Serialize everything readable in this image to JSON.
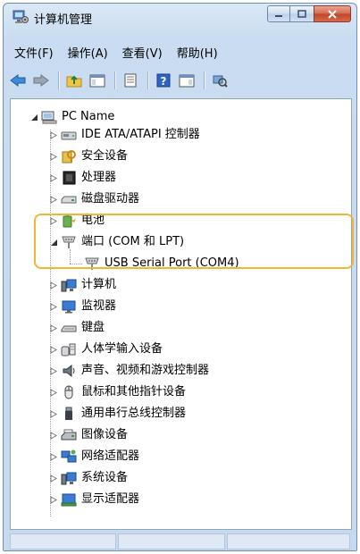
{
  "window": {
    "title": "计算机管理"
  },
  "menu": [
    {
      "label": "文件(F)"
    },
    {
      "label": "操作(A)"
    },
    {
      "label": "查看(V)"
    },
    {
      "label": "帮助(H)"
    }
  ],
  "tree": {
    "root": {
      "label": "PC Name",
      "expanded": true
    },
    "items": [
      {
        "label": "IDE ATA/ATAPI 控制器",
        "icon": "ide-controller-icon"
      },
      {
        "label": "安全设备",
        "icon": "security-device-icon"
      },
      {
        "label": "处理器",
        "icon": "processor-icon"
      },
      {
        "label": "磁盘驱动器",
        "icon": "disk-drive-icon"
      },
      {
        "label": "电池",
        "icon": "battery-icon"
      },
      {
        "label": "端口 (COM 和 LPT)",
        "icon": "port-icon",
        "expanded": true,
        "children": [
          {
            "label": "USB Serial Port (COM4)",
            "icon": "port-icon"
          }
        ]
      },
      {
        "label": "计算机",
        "icon": "computer-icon"
      },
      {
        "label": "监视器",
        "icon": "monitor-icon"
      },
      {
        "label": "键盘",
        "icon": "keyboard-icon"
      },
      {
        "label": "人体学输入设备",
        "icon": "hid-icon"
      },
      {
        "label": "声音、视频和游戏控制器",
        "icon": "sound-icon"
      },
      {
        "label": "鼠标和其他指针设备",
        "icon": "mouse-icon"
      },
      {
        "label": "通用串行总线控制器",
        "icon": "usb-controller-icon"
      },
      {
        "label": "图像设备",
        "icon": "imaging-device-icon"
      },
      {
        "label": "网络适配器",
        "icon": "network-adapter-icon"
      },
      {
        "label": "系统设备",
        "icon": "system-device-icon"
      },
      {
        "label": "显示适配器",
        "icon": "display-adapter-icon"
      }
    ]
  },
  "colors": {
    "highlight": "#f2b534",
    "window_frame": "#6f8fb3",
    "close_button": "#c2442a"
  }
}
